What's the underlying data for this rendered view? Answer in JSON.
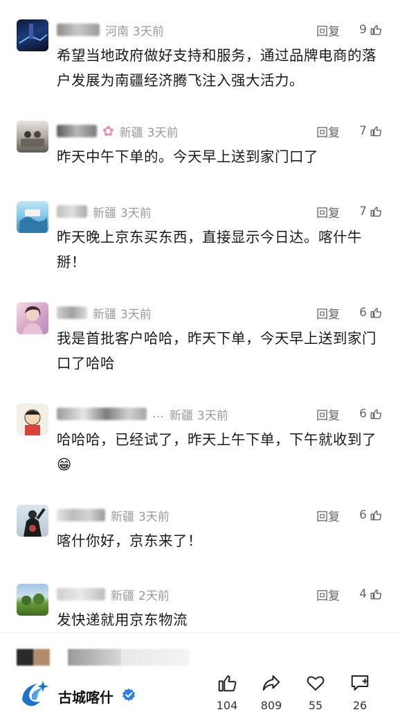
{
  "comments": [
    {
      "region": "河南",
      "time": "3天前",
      "reply": "回复",
      "likes": "9",
      "text": "希望当地政府做好支持和服务，通过品牌电商的落户发展为南疆经济腾飞注入强大活力。"
    },
    {
      "region": "新疆",
      "time": "3天前",
      "reply": "回复",
      "likes": "7",
      "text": "昨天中午下单的。今天早上送到家门口了"
    },
    {
      "region": "新疆",
      "time": "3天前",
      "reply": "回复",
      "likes": "7",
      "text": "昨天晚上京东买东西，直接显示今日达。喀什牛掰！"
    },
    {
      "region": "新疆",
      "time": "3天前",
      "reply": "回复",
      "likes": "6",
      "text": "我是首批客户哈哈，昨天下单，今天早上送到家门口了哈哈"
    },
    {
      "region": "新疆",
      "time": "3天前",
      "reply": "回复",
      "likes": "6",
      "name_suffix": "…",
      "text": "哈哈哈，已经试了，昨天上午下单，下午就收到了😁"
    },
    {
      "region": "新疆",
      "time": "3天前",
      "reply": "回复",
      "likes": "6",
      "text": "喀什你好，京东来了！"
    },
    {
      "region": "新疆",
      "time": "2天前",
      "reply": "回复",
      "likes": "4",
      "text": "发快递就用京东物流"
    }
  ],
  "footer": {
    "brand_name": "古城喀什",
    "like_count": "104",
    "share_count": "809",
    "favorite_count": "55",
    "comment_count": "26",
    "icons": [
      "thumbs-up-icon",
      "share-icon",
      "heart-icon",
      "comment-add-icon"
    ],
    "brand_color": "#1e73c8",
    "verified_color": "#2f7de1"
  }
}
